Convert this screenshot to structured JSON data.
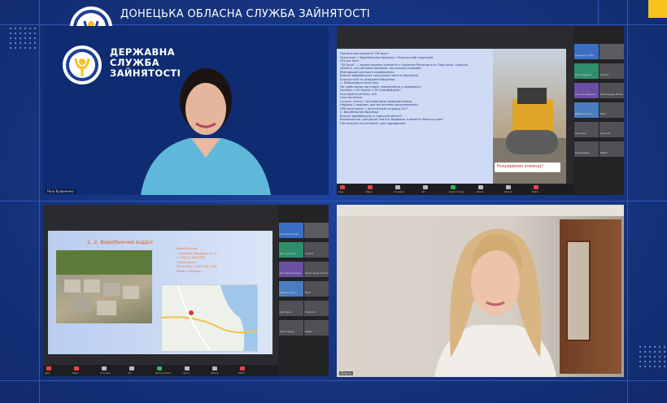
{
  "header": {
    "title": "ДОНЕЦЬКА ОБЛАСНА  СЛУЖБА ЗАЙНЯТОСТІ",
    "logo_text": "ДЕРЖАВНА СЛУЖБА ЗАЙНЯТОСТІ"
  },
  "colors": {
    "background": "#14307a",
    "accent_yellow": "#f7c31c",
    "header_text": "#ffffff"
  },
  "tiles": {
    "top_left": {
      "brand_lines": [
        "ДЕРЖАВНА",
        "СЛУЖБА",
        "ЗАЙНЯТОСТІ"
      ],
      "participant_name": "Ніна Кравченко"
    },
    "top_right": {
      "slide_lines": [
        "Презентація компанії \"СВ Брук\"",
        "Транспорт • Виробництво бруківки • Благоустрій територій",
        "Хто ми такі?",
        "\"СВ Брук\" — зареєстрована компанія з головним бізнесом в м. Подільськ, Одеська",
        "область, яка активно розвиває три основні напрями:",
        "",
        "Міжнародні вантажні перевезення",
        "",
        "Власне виробництво тротуарної плитки (бруківки)",
        "",
        "Благоустрій та укладання бруківки",
        "1. Міжнародна логістика",
        "Ми здійснюємо регулярні перевезення у напрямках:",
        "Україна ↔ ЄС Бруно ↔ ЄС Азербайджан",
        "інші країни регіону: Азії",
        "Наш автопарк:",
        "Сучасні тягачі з тентованими напівпричепами",
        "Нерідко 2 водіями, але ми активно розширюємось",
        "GPS-моніторинг і логістичний супровід 24/7",
        "2. Виробництво бруківки",
        "Власне виробництво в Одеській області",
        "",
        "Високоякісна тротуарна плитка, бордюри, елементи благоустрою",
        "Постачання по регіонам і для підрядників"
      ],
      "banner": "Розширюємо команду!"
    },
    "bottom_left": {
      "slide_title": "2. 2. Виробничий відділ",
      "slide_info": [
        "Виробництво:",
        "• Бруківка, бордюри та ін.",
        "• +38 (0) 123 4567",
        "Прейскурант",
        "Логістика: +380 (00) 1234",
        "Умови співпраці"
      ]
    },
    "bottom_right": {
      "participant_name": "Ольга"
    }
  },
  "side_participants": [
    {
      "name": "Донецька ОЦЗ"
    },
    {
      "name": ""
    },
    {
      "name": "Вікт Руденко"
    },
    {
      "name": "Сергій"
    },
    {
      "name": "Оксана Удовина"
    },
    {
      "name": "Олександр Лосєв"
    },
    {
      "name": "Дарма Ольга"
    },
    {
      "name": "Віра"
    },
    {
      "name": "Світлана"
    },
    {
      "name": "Олексій"
    },
    {
      "name": "Олександр"
    },
    {
      "name": "Марія"
    }
  ],
  "toolbar_labels": [
    "Звук",
    "Відео",
    "Учасники",
    "Чат",
    "Демонстрація",
    "Запис",
    "Реакції",
    "Вийти"
  ]
}
